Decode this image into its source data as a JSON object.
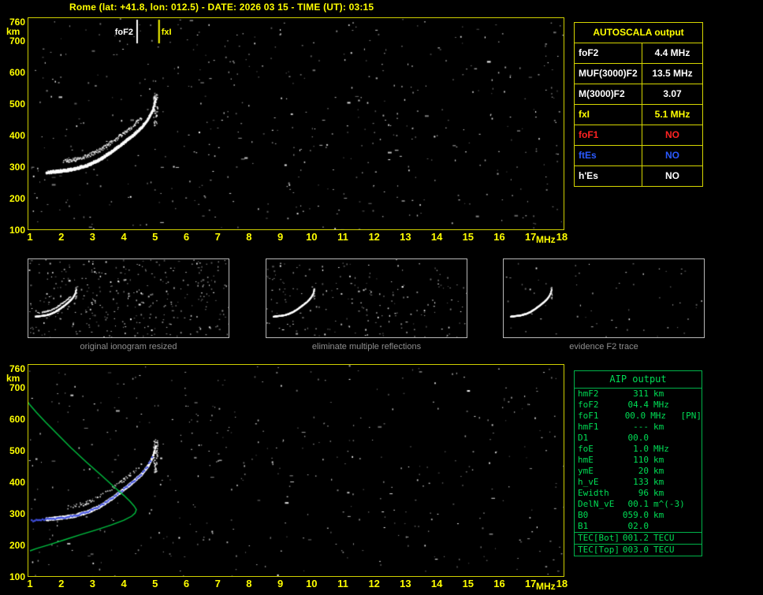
{
  "title": "Rome (lat: +41.8, lon: 012.5) - DATE: 2026 03 15 - TIME (UT): 03:15",
  "axes": {
    "y_unit": "km",
    "x_unit": "MHz",
    "y_ticks": [
      760,
      700,
      600,
      500,
      400,
      300,
      200,
      100
    ],
    "x_ticks": [
      1,
      2,
      3,
      4,
      5,
      6,
      7,
      8,
      9,
      10,
      11,
      12,
      13,
      14,
      15,
      16,
      17,
      18
    ]
  },
  "autoscala_table": {
    "header": "AUTOSCALA output",
    "rows": [
      {
        "name": "foF2",
        "value": "4.4 MHz",
        "color": "#ffffff"
      },
      {
        "name": "MUF(3000)F2",
        "value": "13.5 MHz",
        "color": "#ffffff"
      },
      {
        "name": "M(3000)F2",
        "value": "3.07",
        "color": "#ffffff"
      },
      {
        "name": "fxI",
        "value": "5.1 MHz",
        "color": "#ffff00"
      },
      {
        "name": "foF1",
        "value": "NO",
        "color": "#ff2222"
      },
      {
        "name": "ftEs",
        "value": "NO",
        "color": "#2a5aff"
      },
      {
        "name": "h'Es",
        "value": "NO",
        "color": "#ffffff"
      }
    ]
  },
  "aip_table": {
    "header": "AIP output",
    "rows": [
      {
        "name": "hmF2",
        "value": "311",
        "unit": "km",
        "note": ""
      },
      {
        "name": "foF2",
        "value": "04.4",
        "unit": "MHz",
        "note": ""
      },
      {
        "name": "foF1",
        "value": "00.0",
        "unit": "MHz",
        "note": "[PN]"
      },
      {
        "name": "hmF1",
        "value": "---",
        "unit": "km",
        "note": ""
      },
      {
        "name": "D1",
        "value": "00.0",
        "unit": "",
        "note": ""
      },
      {
        "name": "foE",
        "value": "1.0",
        "unit": "MHz",
        "note": ""
      },
      {
        "name": "hmE",
        "value": "110",
        "unit": "km",
        "note": ""
      },
      {
        "name": "ymE",
        "value": "20",
        "unit": "km",
        "note": ""
      },
      {
        "name": "h_vE",
        "value": "133",
        "unit": "km",
        "note": ""
      },
      {
        "name": "Ewidth",
        "value": "96",
        "unit": "km",
        "note": ""
      },
      {
        "name": "DelN_vE",
        "value": "00.1",
        "unit": "m^(-3)",
        "note": ""
      },
      {
        "name": "B0",
        "value": "059.0",
        "unit": "km",
        "note": ""
      },
      {
        "name": "B1",
        "value": "02.0",
        "unit": "",
        "note": ""
      },
      {
        "name": "TEC[Bot]",
        "value": "001.2",
        "unit": "TECU",
        "note": "",
        "sep": true
      },
      {
        "name": "TEC[Top]",
        "value": "003.0",
        "unit": "TECU",
        "note": "",
        "sep": true
      }
    ]
  },
  "thumbnails": [
    {
      "caption": "original ionogram resized",
      "noise_points": 360,
      "second_branch": true
    },
    {
      "caption": "eliminate multiple reflections",
      "noise_points": 200,
      "second_branch": false
    },
    {
      "caption": "evidence F2 trace",
      "noise_points": 60,
      "second_branch": false
    }
  ],
  "chart_data": [
    {
      "id": "scaled_ionogram",
      "type": "scatter",
      "title": "Autoscala scaled ionogram",
      "xlabel": "MHz",
      "ylabel": "km",
      "xlim": [
        1,
        18
      ],
      "ylim": [
        100,
        760
      ],
      "grid": false,
      "f2_trace": [
        [
          1.5,
          282
        ],
        [
          2.0,
          287
        ],
        [
          2.4,
          293
        ],
        [
          2.8,
          304
        ],
        [
          3.2,
          322
        ],
        [
          3.6,
          348
        ],
        [
          4.0,
          378
        ],
        [
          4.3,
          402
        ],
        [
          4.55,
          425
        ],
        [
          4.75,
          450
        ],
        [
          4.9,
          478
        ],
        [
          5.0,
          515
        ]
      ],
      "second_branch": true,
      "noise_points": 520,
      "markers": [
        {
          "label": "foF2",
          "x": 4.4,
          "color": "#ffffff",
          "label_side": "left"
        },
        {
          "label": "fxI",
          "x": 5.1,
          "color": "#ffff00",
          "label_side": "right"
        }
      ],
      "scaled_values": {
        "foF2_MHz": 4.4,
        "fxI_MHz": 5.1,
        "MUF3000F2_MHz": 13.5,
        "M3000F2": 3.07
      }
    },
    {
      "id": "profile_ionogram",
      "type": "scatter",
      "title": "ionogram with AIP electron density profile",
      "xlabel": "MHz",
      "ylabel": "km",
      "xlim": [
        1,
        18
      ],
      "ylim": [
        100,
        760
      ],
      "grid": false,
      "f2_trace": [
        [
          1.5,
          282
        ],
        [
          2.0,
          287
        ],
        [
          2.4,
          293
        ],
        [
          2.8,
          304
        ],
        [
          3.2,
          322
        ],
        [
          3.6,
          348
        ],
        [
          4.0,
          378
        ],
        [
          4.3,
          402
        ],
        [
          4.55,
          425
        ],
        [
          4.75,
          450
        ],
        [
          4.9,
          478
        ],
        [
          5.0,
          515
        ]
      ],
      "second_branch": "faint",
      "noise_points": 430,
      "fitted_trace": {
        "color": "#4050e0"
      },
      "profile_color": "#00c040",
      "profile": [
        [
          0.88,
          660
        ],
        [
          1.0,
          643
        ],
        [
          1.2,
          620
        ],
        [
          1.5,
          588
        ],
        [
          1.9,
          548
        ],
        [
          2.3,
          508
        ],
        [
          2.8,
          462
        ],
        [
          3.3,
          418
        ],
        [
          3.7,
          382
        ],
        [
          4.0,
          356
        ],
        [
          4.2,
          337
        ],
        [
          4.33,
          322
        ],
        [
          4.4,
          311
        ],
        [
          4.36,
          300
        ],
        [
          4.25,
          290
        ],
        [
          4.0,
          277
        ],
        [
          3.6,
          262
        ],
        [
          3.1,
          246
        ],
        [
          2.6,
          231
        ],
        [
          2.1,
          215
        ],
        [
          1.6,
          199
        ],
        [
          1.2,
          187
        ],
        [
          1.0,
          180
        ]
      ],
      "profile_peak": {
        "hmF2_km": 311,
        "foF2_MHz": 4.4
      }
    }
  ]
}
